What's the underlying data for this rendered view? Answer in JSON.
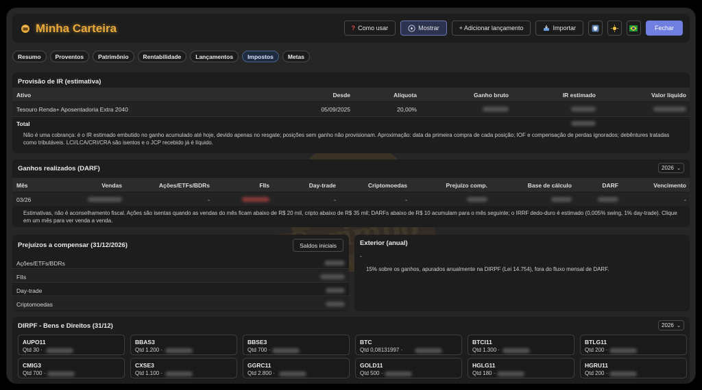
{
  "app": {
    "title": "Minha Carteira"
  },
  "header": {
    "how_to_label": "Como usar",
    "show_label": "Mostrar",
    "add_label": "+ Adicionar lançamento",
    "import_label": "Importar",
    "close_label": "Fechar"
  },
  "tabs": [
    {
      "label": "Resumo"
    },
    {
      "label": "Proventos"
    },
    {
      "label": "Patrimônio"
    },
    {
      "label": "Rentabilidade"
    },
    {
      "label": "Lançamentos"
    },
    {
      "label": "Impostos",
      "active": true
    },
    {
      "label": "Metas"
    }
  ],
  "ir": {
    "title": "Provisão de IR (estimativa)",
    "columns": [
      "Ativo",
      "Desde",
      "Alíquota",
      "Ganho bruto",
      "IR estimado",
      "Valor líquido"
    ],
    "rows": [
      {
        "ativo": "Tesouro Renda+ Aposentadoria Extra 2040",
        "desde": "05/09/2025",
        "aliquota": "20,00%"
      }
    ],
    "total_label": "Total",
    "note": "Não é uma cobrança: é o IR estimado embutido no ganho acumulado até hoje, devido apenas no resgate; posições sem ganho não provisionam. Aproximação: data da primeira compra de cada posição; IOF e compensação de perdas ignorados; debêntures tratadas como tributáveis. LCI/LCA/CRI/CRA são isentos e o JCP recebido já é líquido."
  },
  "darf": {
    "title": "Ganhos realizados (DARF)",
    "year": "2026",
    "columns": [
      "Mês",
      "Vendas",
      "Ações/ETFs/BDRs",
      "FIIs",
      "Day-trade",
      "Criptomoedas",
      "Prejuízo comp.",
      "Base de cálculo",
      "DARF",
      "Vencimento"
    ],
    "rows": [
      {
        "mes": "03/26",
        "acoes": "-",
        "daytrade": "-",
        "cripto": "-",
        "vencimento": "-"
      }
    ],
    "note": "Estimativas, não é aconselhamento fiscal. Ações são isentas quando as vendas do mês ficam abaixo de R$ 20 mil, cripto abaixo de R$ 35 mil; DARFs abaixo de R$ 10 acumulam para o mês seguinte; o IRRF dedo-duro é estimado (0,005% swing, 1% day-trade). Clique em um mês para ver venda a venda."
  },
  "prejuizos": {
    "title": "Prejuízos a compensar (31/12/2026)",
    "button_label": "Saldos iniciais",
    "items": [
      {
        "label": "Ações/ETFs/BDRs"
      },
      {
        "label": "FIIs"
      },
      {
        "label": "Day-trade"
      },
      {
        "label": "Criptomoedas"
      }
    ]
  },
  "exterior": {
    "title": "Exterior (anual)",
    "value": "-",
    "note": "15% sobre os ganhos, apurados anualmente na DIRPF (Lei 14.754), fora do fluxo mensal de DARF."
  },
  "dirpf": {
    "title": "DIRPF - Bens e Direitos (31/12)",
    "year": "2026",
    "cards": [
      {
        "ticker": "AUPO11",
        "qtd": "Qtd 30 ·"
      },
      {
        "ticker": "BBAS3",
        "qtd": "Qtd 1.200 ·"
      },
      {
        "ticker": "BBSE3",
        "qtd": "Qtd 700 ·"
      },
      {
        "ticker": "BTC",
        "qtd": "Qtd 0,08131997 ·"
      },
      {
        "ticker": "BTCI11",
        "qtd": "Qtd 1.300 ·"
      },
      {
        "ticker": "BTLG11",
        "qtd": "Qtd 200 ·"
      },
      {
        "ticker": "CMIG3",
        "qtd": "Qtd 700 ·"
      },
      {
        "ticker": "CXSE3",
        "qtd": "Qtd 1.100 ·"
      },
      {
        "ticker": "GGRC11",
        "qtd": "Qtd 2.800 ·"
      },
      {
        "ticker": "GOLD11",
        "qtd": "Qtd 500 ·"
      },
      {
        "ticker": "HGLG11",
        "qtd": "Qtd 180 ·"
      },
      {
        "ticker": "HGRU11",
        "qtd": "Qtd 200 ·"
      }
    ]
  },
  "watermark": {
    "name": "Garimpo",
    "tagline": "Deep Market Prospecting"
  },
  "colors": {
    "brand": "#e8a93a",
    "primary": "#6f7fe0",
    "panel": "#1d1d1d",
    "app_bg": "#262626"
  }
}
